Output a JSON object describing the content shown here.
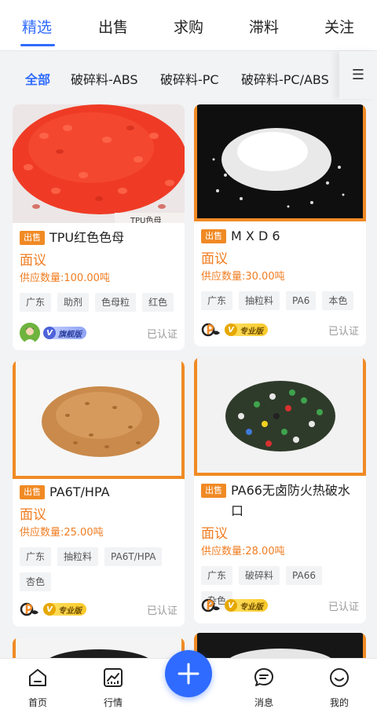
{
  "top_tabs": [
    {
      "label": "精选",
      "active": true
    },
    {
      "label": "出售",
      "active": false
    },
    {
      "label": "求购",
      "active": false
    },
    {
      "label": "滞料",
      "active": false
    },
    {
      "label": "关注",
      "active": false
    }
  ],
  "categories": [
    {
      "label": "全部",
      "active": true
    },
    {
      "label": "破碎料-ABS"
    },
    {
      "label": "破碎料-PC"
    },
    {
      "label": "破碎料-PC/ABS"
    }
  ],
  "category_menu_icon": "☰",
  "colors": {
    "accent": "#2f6bff",
    "price": "#f07d22",
    "badge": "#f08a24"
  },
  "listings": [
    {
      "badge": "出售",
      "title": "TPU红色色母",
      "price": "面议",
      "supply": "供应数量:100.00吨",
      "tags": [
        "广东",
        "助剂",
        "色母粒",
        "红色"
      ],
      "vip_label": "旗舰版",
      "verified": "已认证",
      "image_watermark": "TPU色母"
    },
    {
      "badge": "出售",
      "title": "M X D 6",
      "price": "面议",
      "supply": "供应数量:30.00吨",
      "tags": [
        "广东",
        "抽粒料",
        "PA6",
        "本色"
      ],
      "vip_label": "专业版",
      "verified": "已认证"
    },
    {
      "badge": "出售",
      "title": "PA6T/HPA",
      "price": "面议",
      "supply": "供应数量:25.00吨",
      "tags": [
        "广东",
        "抽粒料",
        "PA6T/HPA",
        "杏色"
      ],
      "vip_label": "专业版",
      "verified": "已认证"
    },
    {
      "badge": "出售",
      "title": "PA66无卤防火热破水口",
      "price": "面议",
      "supply": "供应数量:28.00吨",
      "tags": [
        "广东",
        "破碎料",
        "PA66",
        "杂色"
      ],
      "vip_label": "专业版",
      "verified": "已认证"
    }
  ],
  "bottom_nav": [
    {
      "label": "首页",
      "icon": "home-icon"
    },
    {
      "label": "行情",
      "icon": "market-chart-icon"
    },
    {
      "label": "消息",
      "icon": "message-icon"
    },
    {
      "label": "我的",
      "icon": "profile-smile-icon"
    }
  ],
  "fab_icon": "plus-icon"
}
